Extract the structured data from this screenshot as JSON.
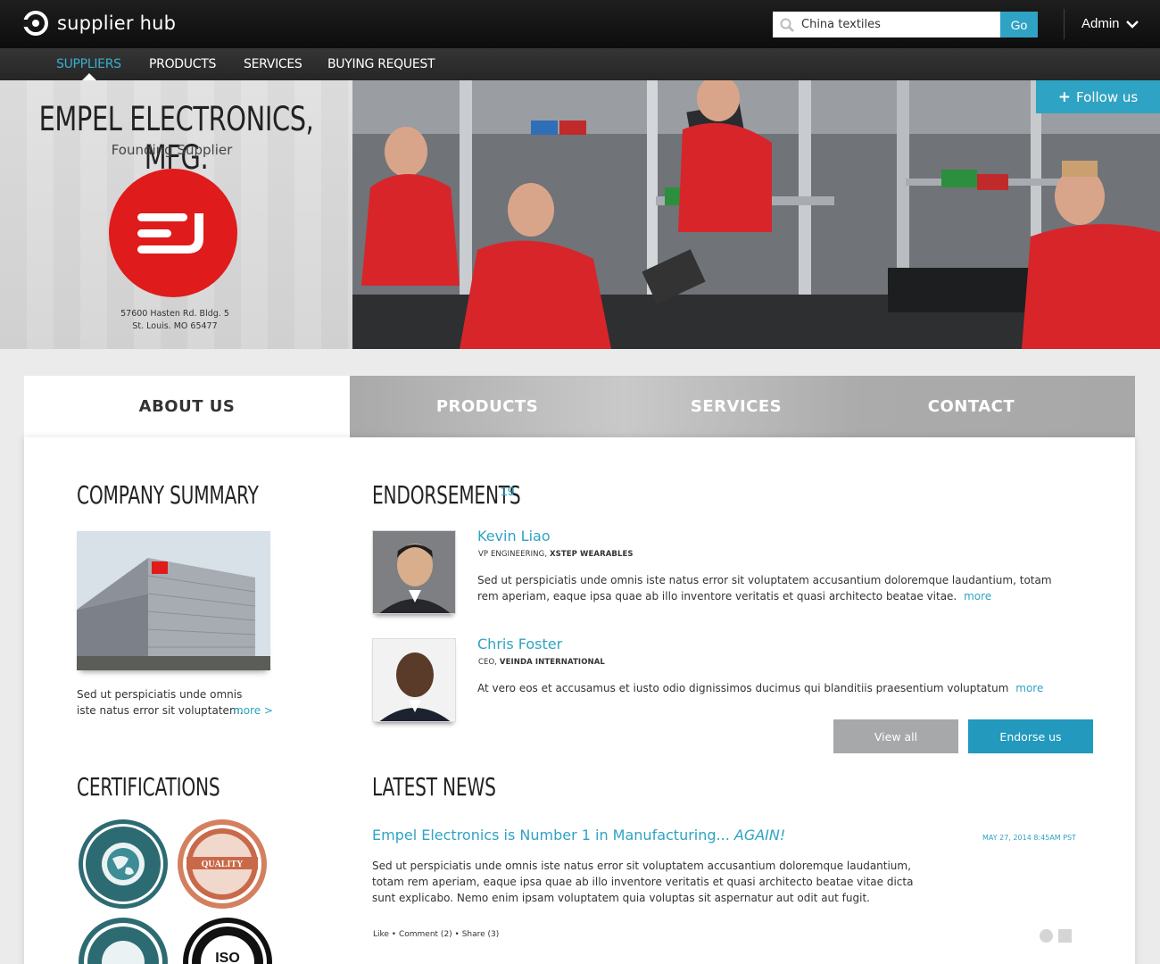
{
  "header": {
    "app_name": "supplier hub",
    "search": {
      "value": "China textiles",
      "button_label": "Go"
    },
    "user_menu_label": "Admin"
  },
  "nav": {
    "items": [
      {
        "label": "SUPPLIERS",
        "active": true
      },
      {
        "label": "PRODUCTS"
      },
      {
        "label": "SERVICES"
      },
      {
        "label": "BUYING REQUEST"
      }
    ]
  },
  "hero": {
    "company_name": "EMPEL ELECTRONICS, MFG.",
    "tagline": "Founding Supplier",
    "address_line1": "57600 Hasten Rd. Bldg. 5",
    "address_line2": "St. Louis. MO 65477",
    "follow_label": "Follow us",
    "brand_color": "#e01b1b"
  },
  "tabs": [
    {
      "label": "ABOUT US",
      "active": true
    },
    {
      "label": "PRODUCTS"
    },
    {
      "label": "SERVICES"
    },
    {
      "label": "CONTACT"
    }
  ],
  "company_summary": {
    "title": "COMPANY SUMMARY",
    "text": "Sed ut perspiciatis unde omnis iste natus error sit voluptatem.",
    "more_label": "more >"
  },
  "certifications": {
    "title": "CERTIFICATIONS",
    "badges": [
      "SOCIAL RESPONSIBILITY",
      "QUALITY",
      "MINIMUM AGE",
      "ISO"
    ]
  },
  "endorsements": {
    "title": "ENDORSEMENTS",
    "count": "19",
    "items": [
      {
        "name": "Kevin Liao",
        "role": "VP ENGINEERING,",
        "org": "XSTEP WEARABLES",
        "text": "Sed ut perspiciatis unde omnis iste natus error sit voluptatem accusantium doloremque laudantium, totam rem aperiam, eaque ipsa quae ab illo inventore veritatis et quasi architecto beatae vitae.",
        "more": "more"
      },
      {
        "name": "Chris Foster",
        "role": "CEO,",
        "org": "VEINDA INTERNATIONAL",
        "text": "At vero eos et accusamus et iusto odio dignissimos ducimus qui blanditiis praesentium voluptatum",
        "more": "more"
      }
    ],
    "view_all_label": "View all",
    "endorse_label": "Endorse us"
  },
  "news": {
    "title": "LATEST NEWS",
    "headline": "Empel Electronics is Number 1 in Manufacturing... ",
    "headline_emphasis": "AGAIN!",
    "date": "MAY 27, 2014 8:45AM PST",
    "body": "Sed ut perspiciatis unde omnis iste natus error sit voluptatem accusantium doloremque laudantium, totam rem aperiam, eaque ipsa quae ab illo inventore veritatis et quasi architecto beatae vitae dicta sunt explicabo. Nemo enim ipsam voluptatem quia voluptas sit aspernatur aut odit aut fugit.",
    "actions": "Like • Comment (2) • Share (3)"
  },
  "colors": {
    "accent": "#2fa3c3",
    "brand": "#e01b1b",
    "dark": "#1a1a1a"
  }
}
